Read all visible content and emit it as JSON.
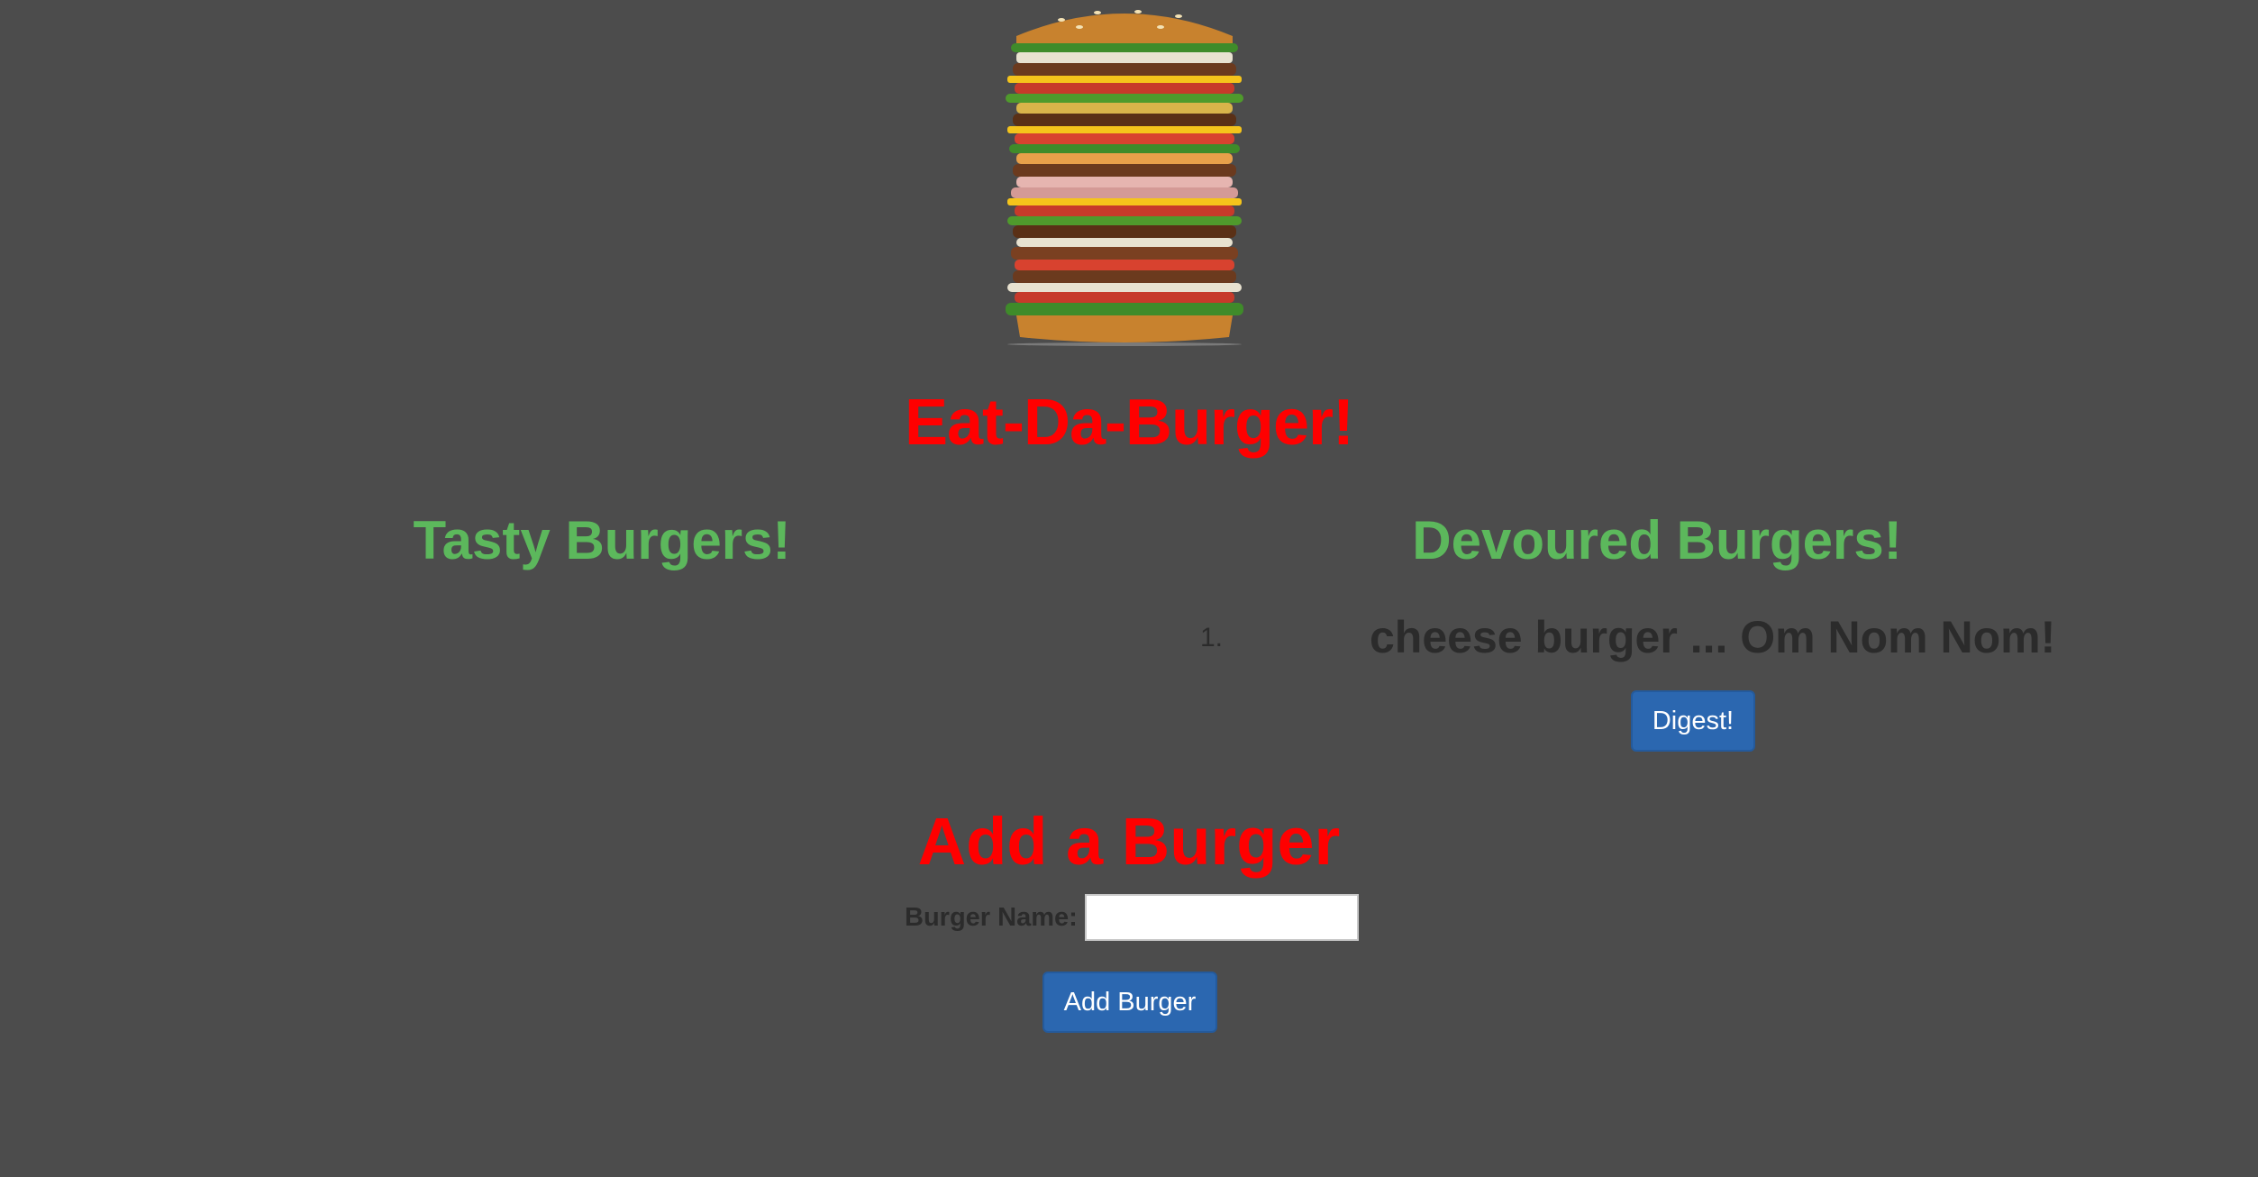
{
  "header": {
    "image_name": "stacked-burger-image",
    "title": "Eat-Da-Burger!"
  },
  "tasty": {
    "heading": "Tasty Burgers!",
    "items": []
  },
  "devoured": {
    "heading": "Devoured Burgers!",
    "items": [
      {
        "number": "1.",
        "text": "cheese burger ... Om Nom Nom!",
        "button_label": "Digest!"
      }
    ]
  },
  "form": {
    "title": "Add a Burger",
    "label": "Burger Name:",
    "input_value": "",
    "input_placeholder": "",
    "submit_label": "Add Burger"
  },
  "colors": {
    "background": "#4c4c4c",
    "title_red": "#ff0000",
    "heading_green": "#5cb85c",
    "button_blue": "#2b67b0"
  }
}
